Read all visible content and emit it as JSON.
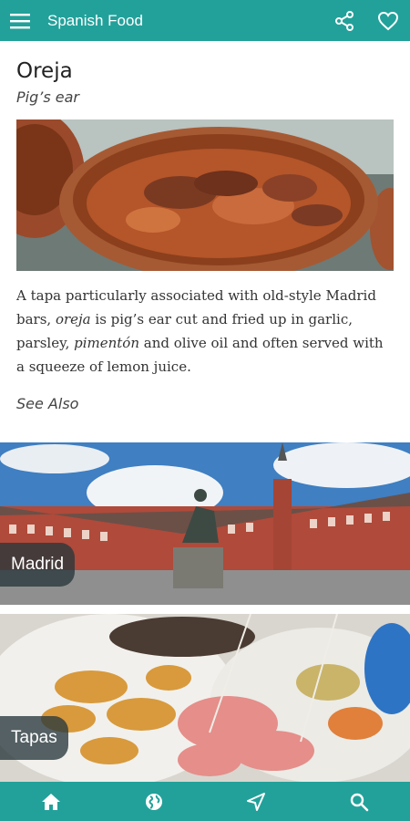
{
  "app": {
    "title": "Spanish Food"
  },
  "colors": {
    "brand": "#22a19a"
  },
  "icons": {
    "menu": "hamburger-menu-icon",
    "share": "share-icon",
    "favorite": "heart-icon",
    "home": "home-icon",
    "globe": "globe-icon",
    "navigate": "location-arrow-icon",
    "search": "search-icon"
  },
  "article": {
    "title": "Oreja",
    "subtitle": "Pig’s ear",
    "desc_1": "A tapa particularly associated with old-style Madrid bars, ",
    "desc_em1": "oreja",
    "desc_2": " is pig’s ear cut and fried up in garlic, parsley, ",
    "desc_em2": "pimentón",
    "desc_3": " and olive oil and often served with a squeeze of lemon juice.",
    "see_also": "See Also"
  },
  "related": [
    {
      "label": "Madrid"
    },
    {
      "label": "Tapas"
    }
  ]
}
